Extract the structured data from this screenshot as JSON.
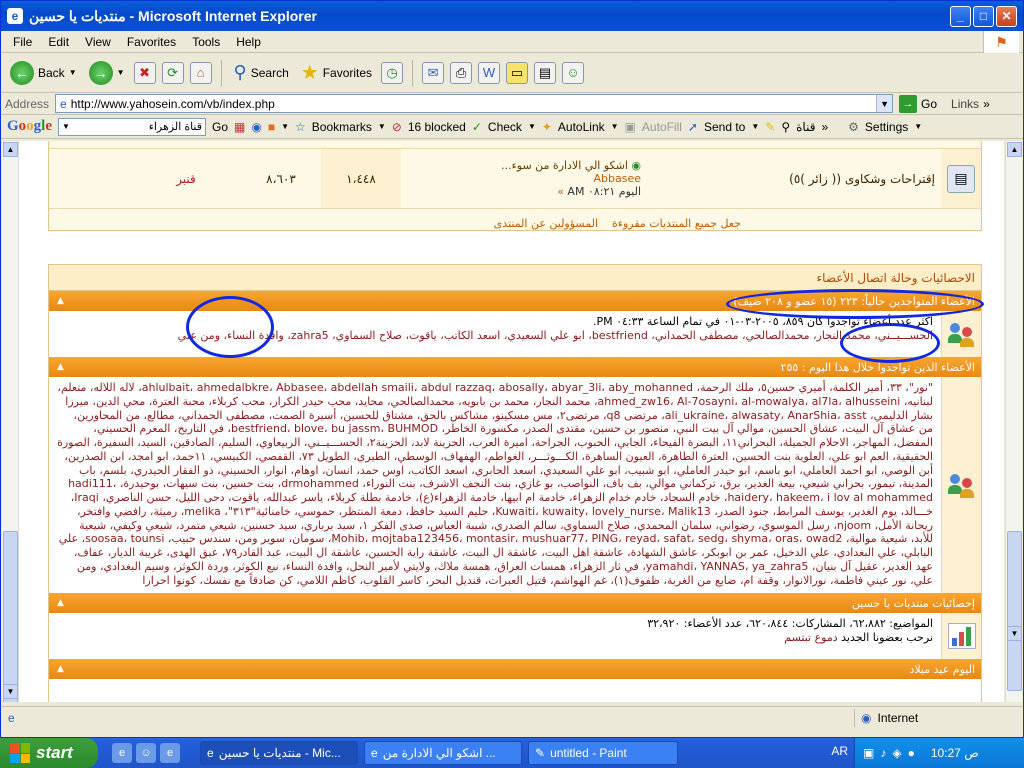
{
  "window": {
    "title": "منتديات يا حسين - Microsoft Internet Explorer"
  },
  "menu": [
    "File",
    "Edit",
    "View",
    "Favorites",
    "Tools",
    "Help"
  ],
  "toolbar": {
    "back": "Back",
    "search": "Search",
    "favorites": "Favorites"
  },
  "address": {
    "label": "Address",
    "url": "http://www.yahosein.com/vb/index.php",
    "go": "Go",
    "links": "Links"
  },
  "google": {
    "search_value": "قناة الزهراء",
    "go": "Go",
    "bookmarks": "Bookmarks",
    "blocked": "16 blocked",
    "check": "Check",
    "autolink": "AutoLink",
    "autofill": "AutoFill",
    "sendto": "Send to",
    "qanat": "قناة",
    "settings": "Settings"
  },
  "forum": {
    "row": {
      "title": "إقتراحات وشكاوى (( زائر )٥)",
      "last_post_title": "اشكو الي الادارة من سوء...",
      "last_post_by": "Abbasee",
      "last_post_time": "اليوم ٠٨:٢١ AM",
      "threads": "١،٤٤٨",
      "posts": "٨،٦٠٣",
      "moderator": "قنبر"
    },
    "links": {
      "mark_read": "جعل جميع المنتديات مقروءة",
      "staff": "المسؤولين عن المنتدى"
    }
  },
  "stats": {
    "heading": "الاحصائيات وحالة اتصال الأعضاء",
    "online_bar": "الأعضاء المتواجدين حالياً: ٢٢٣ (١٥ عضو و ٢٠٨ ضيف)",
    "online_line1": "أكثر عدد أعضاء تواجدوا كان ٨٥٩، ٢٠٠٥-٠٣-٠١ في تمام الساعة ٠٤:٣٣ PM.",
    "online_line2": "الحســـيــني، محمد النجار، محمدالصالحي، مصطفى الحمداني، bestfriend، ابو علي السعيدي، اسعد الكاتب، ياقوت، صلاح السماوي، zahra5، وافدة النساء، ومن علي",
    "today_bar": "الأعضاء الذين تواجدوا خلال هذا اليوم : ٢٥٥",
    "today_text": "\"نور\"، ٣٣، أمير الكلمة، أميري حسين٥، ملك الرحمة، ahlulbait، ahmedalbkre، Abbasee، abdellah smaili، abdul razzaq، abosally، abyar_3li، aby_mohanned، لاله اللاله، متعلم، لبنانيه، ahmed_zw16، Al-7osayni، al-mowalya، al7la، alhusseini، محمد النجار، محمد بن بابويه، محمدالصالحي، محايد، محب حيدر الكرار، محب كربلاء، محبة العترة، محي الدين، ميرزا بشار الدليمي، ali_ukraine، alwasaty، AnarShia، asst، مرتضى q8، مرتضى٢، مس مسكينو، مشاكس بالحق، مشتاق للحسين، أسيرة الصمت، مصطفى الحمداني، مطالع، من المحاورين، من عشاق آل البيت، عشاق الحسين، موالي آل بيت النبي، منصور بن حسين، مقتدى الصدر، مكسورة الخاطر، bestfriend، blove، bu jassm، BUHMOD، في التاريخ، المغرم الحسيني، المفضل، المهاجر، الاحلام الجميلة، البحراني١١، البصرة الفيحاء، الجابي، الحبوب، الجراحة، اميرة العرب، الحزينة لابد، الحزينة٢، الحســـيــني، الربيعاوي، السليم، الصادقين، السيد، السفيرة، الصورة الحقيقية، العم ابو علي، العلوية بنت الحسين، العترة الطاهرة، العيون الساهرة، الكـــوثـــر، الغواطم، الهفهاف، الوسطي، الطيري، الطويل ٧٣، القفصي، الكبيسي، ١١حمد، ابو امجد، ابن الصدرين، أبن الوصي، ابو احمد العاملي، ابو باسم، ابو حيدر العاملي، ابو شبيب، ابو علي السعيدي، اسعد الجابري، اسعد الكاتب، اوس حمد، انسان، اوهام، انوار، الحسيني، ذو الفقار الحيدري، بلسم، باب المدينة، تيمور، بحراني شيعي، بيعة الغدير، برق، تركماني موالي، بف باف، النواصب، بو غازي، بنت النجف الاشرف، بنت النوراء، drmohammed، بنت حسين، بنت سيهات، بوحيدرة، hadi111، haidery، hakeem، i lov al mohammed، خادم السجاد، خادم خدام الزهراء، خادمة ام ابيها، خادمة الزهراء(ع)، خادمة بطلة كربلاء، ياسر عبدالله، ياقوت، دجى الليل، حسن الناصري، Iraqi، خـــالد، يوم الغدير، يوسف المرابط، جنود الصدر، Kuwaiti، kuwaity، lovely_nurse، Malik13، حليم السيد حافظ، دمعة المنتظر، حموسي، خامنائية\"٣١٣\"، melika، رميثة، رافضي وافتخر، ريحانة الأمل، njoom، رسل الموسوي، رضواني، سلمان المحمدي، صلاح السماوي، سالم الصدري، شيبة العباس، صدى الفكر ١، سيد برباري، سيد حسنين، شيعي متمرد، شيعي وكيفي، شيعية للأبد، شيعية موالية، Mohib، mojtaba123456، montasir، mushuar77، PING، reyad، safat، sedg، shyma، oras، owad2، سومان، سوير ومن، سندس حبيب، soosaa، tounsi، علي البابلي، علي البغدادي، علي الدخيل، عمر بن ابوبكر، عاشق الشهادة، عاشقة اهل البيت، عاشقة ال البيت، عاشقة راية الحسين، عاشقة ال البيت، عبد القادر٧٩، عبق الهدى، غريبة الديار، عفاف، عهد الغدير، عقيل آل بنيان، yamahdi، YANNAS، ya_zahra5، في ثار الزهراء، همسات العراق، همسة ملاك، ولايتي لأمير النحل، وافدة النساء، نبع الكوثر، وردة الكوثر، وسيم البغدادي، ومن علي، نور عيني فاطمة، نورالانوار، وقفة ام، ضايع من الغربة، ظفوف(١)، غم الهواشم، قتيل العبرات، قنديل البحر، كاسر القلوب، كاظم اللامي، كن صادقاً مع نفسك، كونوا احرارا",
    "forum_stats_bar": "إحصائيات منتديات يا حسين",
    "forum_stats_line": "المواضيع: ٦٢،٨٨٢، المشاركات: ٦٢٠،٨٤٤، عدد الأعضاء: ٣٢،٩٢٠",
    "newest_label": "نرحب بعضونا الجديد",
    "newest_member": "دموع تبتسم",
    "birthday_bar": "اليوم عيد ميلاد"
  },
  "status": {
    "zone": "Internet"
  },
  "taskbar": {
    "start": "start",
    "tasks": [
      "منتديات يا حسين - Mic...",
      "اشكو الي الادارة من ...",
      "untitled - Paint"
    ],
    "lang": "AR",
    "clock": "10:27 ص"
  }
}
